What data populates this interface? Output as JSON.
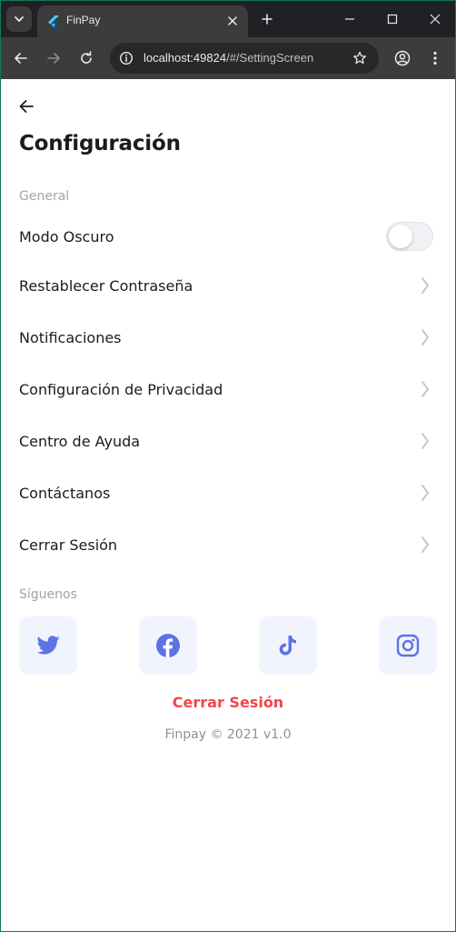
{
  "browser": {
    "tab_title": "FinPay",
    "url_host": "localhost:49824",
    "url_path": "/#/SettingScreen",
    "icons": {
      "tab_search": "chevron-down-icon",
      "favicon": "flutter-logo-icon",
      "tab_close": "close-icon",
      "new_tab": "plus-icon",
      "minimize": "minimize-icon",
      "maximize": "maximize-icon",
      "close_window": "close-icon",
      "back": "arrow-left-icon",
      "forward": "arrow-right-icon",
      "reload": "reload-icon",
      "site_info": "info-icon",
      "bookmark": "star-icon",
      "profile": "profile-icon",
      "menu": "kebab-menu-icon"
    }
  },
  "page": {
    "title": "Configuración",
    "back_icon": "arrow-left-icon"
  },
  "general": {
    "section_label": "General",
    "dark_mode": {
      "label": "Modo Oscuro",
      "enabled": false
    },
    "items": [
      {
        "label": "Restablecer Contraseña"
      },
      {
        "label": "Notificaciones"
      },
      {
        "label": "Configuración de Privacidad"
      },
      {
        "label": "Centro de Ayuda"
      },
      {
        "label": "Contáctanos"
      },
      {
        "label": "Cerrar Sesión"
      }
    ]
  },
  "follow": {
    "section_label": "Síguenos",
    "networks": [
      {
        "icon": "twitter-icon"
      },
      {
        "icon": "facebook-icon"
      },
      {
        "icon": "tiktok-icon"
      },
      {
        "icon": "instagram-icon"
      }
    ]
  },
  "logout_link": "Cerrar Sesión",
  "footer": "Finpay © 2021 v1.0",
  "colors": {
    "accent_blue": "#5c73e6",
    "danger_red": "#f0454b",
    "social_bg": "#f2f4fd",
    "text_dark": "#1b1b1f",
    "text_muted": "#a0a3ab"
  }
}
